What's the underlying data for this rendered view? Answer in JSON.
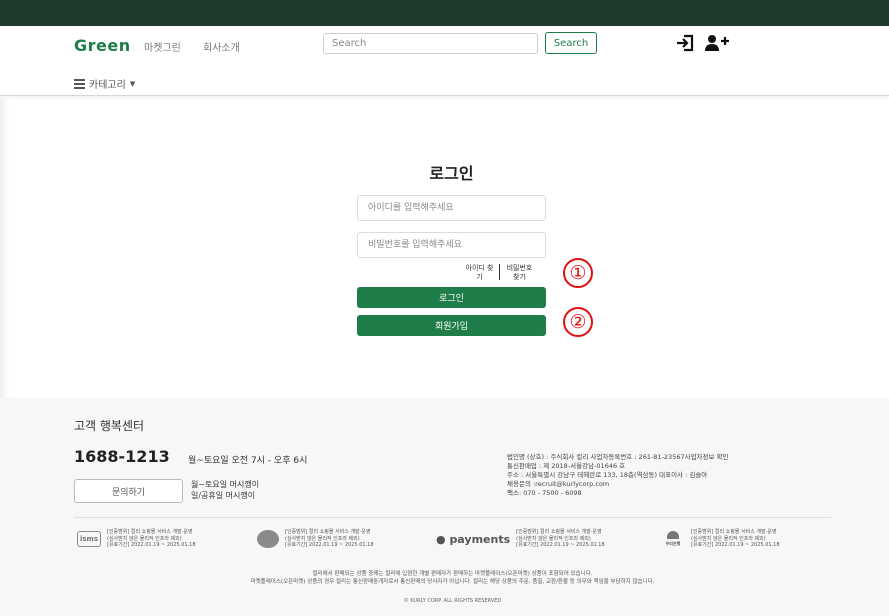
{
  "header": {
    "logo": "Green",
    "nav": [
      "마켓그린",
      "회사소개"
    ],
    "search_placeholder": "Search",
    "search_button": "Search",
    "category_label": "카테고리"
  },
  "login": {
    "title": "로그인",
    "id_placeholder": "아이디를 입력해주세요",
    "pw_placeholder": "비밀번호를 입력해주세요",
    "find_id": "아이디 찾기",
    "find_pw": "비밀번호 찾기",
    "login_button": "로그인",
    "join_button": "회원가입",
    "marker_1": "①",
    "marker_2": "②"
  },
  "footer": {
    "cs_title": "고객 행복센터",
    "phone": "1688-1213",
    "hours": "월~토요일 오전 7시 - 오후 6시",
    "inquiry_button": "문의하기",
    "inquiry_hours_1": "월~토요일 머시깽이",
    "inquiry_hours_2": "일/공휴일 머시깽이",
    "company_lines": [
      "법인명 (상호) : 주식회사 컬리 사업자등록번호 : 261-81-23567사업자정보 확인",
      "통신판매업 : 제 2018-서울강남-01646 호",
      "주소 : 서울특별시 강남구 테헤란로 133, 18층(역삼동) 대표이사 : 김슬아",
      "채용문의 :recruit@kurlycorp.com",
      "팩스: 070 - 7500 - 6098"
    ],
    "certs": [
      {
        "logo": "isms",
        "lines": [
          "[인증범위] 컬리 쇼핑몰 서비스 개발·운영",
          "(심사받지 않은 물리적 인프라 제외)",
          "[유효기간] 2022.01.19 ~ 2025.01.18"
        ]
      },
      {
        "logo": "",
        "lines": [
          "[인증범위] 컬리 쇼핑몰 서비스 개발·운영",
          "(심사받지 않은 물리적 인프라 제외)",
          "[유효기간] 2022.01.19 ~ 2025.01.18"
        ]
      },
      {
        "logo": "payments",
        "lines": [
          "[인증범위] 컬리 쇼핑몰 서비스 개발·운영",
          "(심사받지 않은 물리적 인프라 제외)",
          "[유효기간] 2022.01.19 ~ 2025.01.18"
        ]
      },
      {
        "logo": "우리은행",
        "lines": [
          "[인증범위] 컬리 쇼핑몰 서비스 개발·운영",
          "(심사받지 않은 물리적 인프라 제외)",
          "[유효기간] 2022.01.19 ~ 2025.01.18"
        ]
      }
    ],
    "notice_1": "컬리에서 판매되는 상품 중에는 컬리에 입점한 개별 판매자가 판매하는 마켓플레이스(오픈마켓) 상품이 포함되어 있습니다.",
    "notice_2": "마켓플레이스(오픈마켓) 상품의 경우 컬리는 통신판매중개자로서 통신판매의 당사자가 아닙니다. 컬리는 해당 상품의 주문, 품질, 교환/환불 등 의무와 책임을 부담하지 않습니다.",
    "copyright": "© KURLY CORP. ALL RIGHTS RESERVED"
  }
}
